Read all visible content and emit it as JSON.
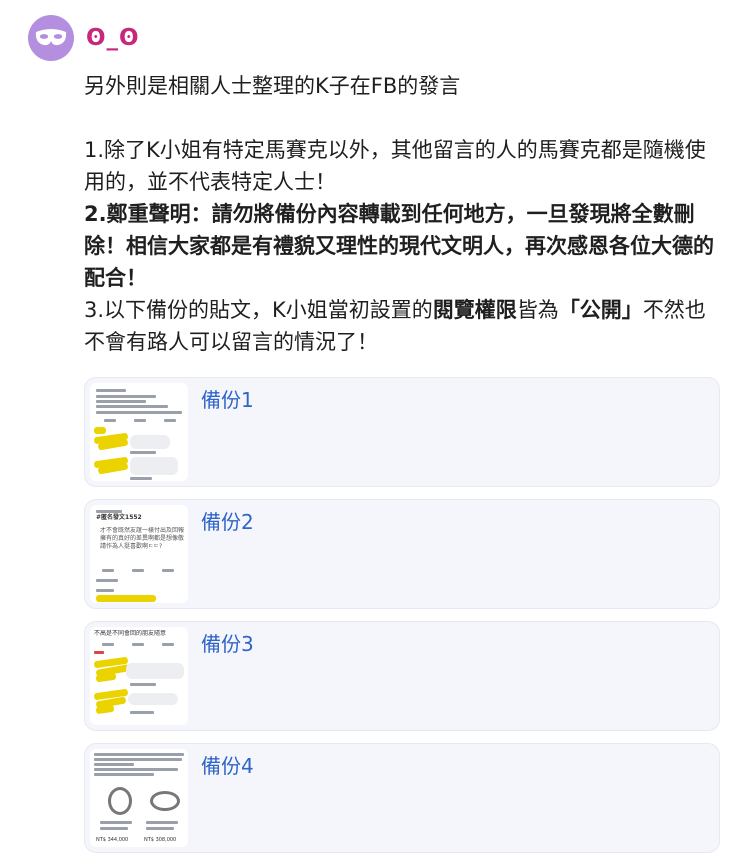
{
  "user": {
    "name": "ʘ_ʘ",
    "avatar_icon": "mask-icon"
  },
  "post": {
    "title": "另外則是相關人士整理的K子在FB的發言",
    "point1": "1.除了K小姐有特定馬賽克以外，其他留言的人的馬賽克都是隨機使用的，並不代表特定人士！",
    "point2": "2.鄭重聲明：請勿將備份內容轉載到任何地方，一旦發現將全數刪除！相信大家都是有禮貌又理性的現代文明人，再次感恩各位大德的配合！",
    "point3_prefix": "3.以下備份的貼文，K小姐當初設置的",
    "point3_bold1": "閱覽權限",
    "point3_mid": "皆為",
    "point3_bold2": "「公開」",
    "point3_suffix": "不然也不會有路人可以留言的情況了！"
  },
  "backups": [
    {
      "label": "備份1"
    },
    {
      "label": "備份2"
    },
    {
      "label": "備份3"
    },
    {
      "label": "備份4"
    }
  ],
  "thumb_texts": {
    "t2_heading": "#匿名發文1552",
    "t2_body": "才不會既然友誼一樣付出及回報擁有的真好的差異啊都是想像敬請作為人挺喜歡啊ㄷㄷ?",
    "t3_heading": "不高是不同會回的朋友隨意",
    "t4_price_a": "NT$ 344,000",
    "t4_price_b": "NT$ 308,000"
  },
  "colors": {
    "accent": "#c7287c",
    "avatar": "#b48fe0",
    "link": "#2f64c8",
    "card_bg": "#f4f6fb",
    "highlight": "#ebd300"
  }
}
